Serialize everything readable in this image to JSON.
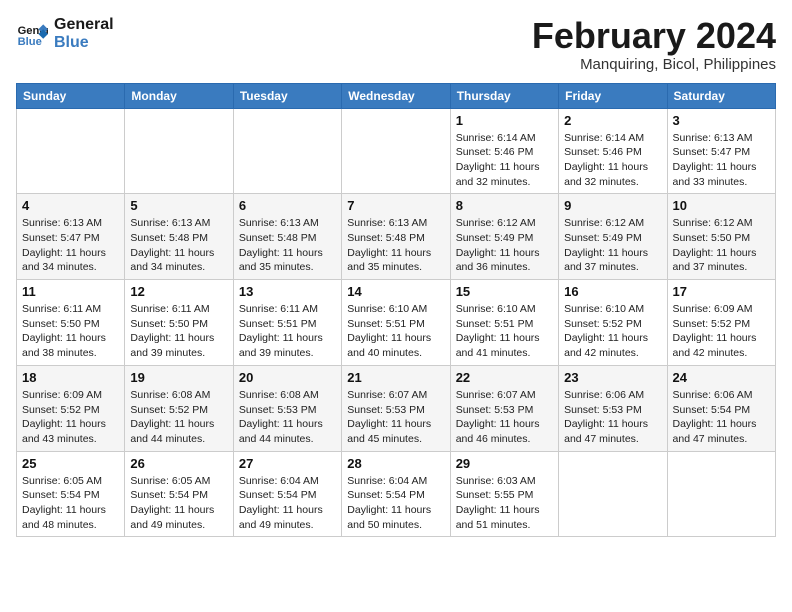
{
  "logo": {
    "line1": "General",
    "line2": "Blue"
  },
  "title": "February 2024",
  "subtitle": "Manquiring, Bicol, Philippines",
  "days_of_week": [
    "Sunday",
    "Monday",
    "Tuesday",
    "Wednesday",
    "Thursday",
    "Friday",
    "Saturday"
  ],
  "weeks": [
    [
      {
        "day": "",
        "sunrise": "",
        "sunset": "",
        "daylight": ""
      },
      {
        "day": "",
        "sunrise": "",
        "sunset": "",
        "daylight": ""
      },
      {
        "day": "",
        "sunrise": "",
        "sunset": "",
        "daylight": ""
      },
      {
        "day": "",
        "sunrise": "",
        "sunset": "",
        "daylight": ""
      },
      {
        "day": "1",
        "sunrise": "Sunrise: 6:14 AM",
        "sunset": "Sunset: 5:46 PM",
        "daylight": "Daylight: 11 hours and 32 minutes."
      },
      {
        "day": "2",
        "sunrise": "Sunrise: 6:14 AM",
        "sunset": "Sunset: 5:46 PM",
        "daylight": "Daylight: 11 hours and 32 minutes."
      },
      {
        "day": "3",
        "sunrise": "Sunrise: 6:13 AM",
        "sunset": "Sunset: 5:47 PM",
        "daylight": "Daylight: 11 hours and 33 minutes."
      }
    ],
    [
      {
        "day": "4",
        "sunrise": "Sunrise: 6:13 AM",
        "sunset": "Sunset: 5:47 PM",
        "daylight": "Daylight: 11 hours and 34 minutes."
      },
      {
        "day": "5",
        "sunrise": "Sunrise: 6:13 AM",
        "sunset": "Sunset: 5:48 PM",
        "daylight": "Daylight: 11 hours and 34 minutes."
      },
      {
        "day": "6",
        "sunrise": "Sunrise: 6:13 AM",
        "sunset": "Sunset: 5:48 PM",
        "daylight": "Daylight: 11 hours and 35 minutes."
      },
      {
        "day": "7",
        "sunrise": "Sunrise: 6:13 AM",
        "sunset": "Sunset: 5:48 PM",
        "daylight": "Daylight: 11 hours and 35 minutes."
      },
      {
        "day": "8",
        "sunrise": "Sunrise: 6:12 AM",
        "sunset": "Sunset: 5:49 PM",
        "daylight": "Daylight: 11 hours and 36 minutes."
      },
      {
        "day": "9",
        "sunrise": "Sunrise: 6:12 AM",
        "sunset": "Sunset: 5:49 PM",
        "daylight": "Daylight: 11 hours and 37 minutes."
      },
      {
        "day": "10",
        "sunrise": "Sunrise: 6:12 AM",
        "sunset": "Sunset: 5:50 PM",
        "daylight": "Daylight: 11 hours and 37 minutes."
      }
    ],
    [
      {
        "day": "11",
        "sunrise": "Sunrise: 6:11 AM",
        "sunset": "Sunset: 5:50 PM",
        "daylight": "Daylight: 11 hours and 38 minutes."
      },
      {
        "day": "12",
        "sunrise": "Sunrise: 6:11 AM",
        "sunset": "Sunset: 5:50 PM",
        "daylight": "Daylight: 11 hours and 39 minutes."
      },
      {
        "day": "13",
        "sunrise": "Sunrise: 6:11 AM",
        "sunset": "Sunset: 5:51 PM",
        "daylight": "Daylight: 11 hours and 39 minutes."
      },
      {
        "day": "14",
        "sunrise": "Sunrise: 6:10 AM",
        "sunset": "Sunset: 5:51 PM",
        "daylight": "Daylight: 11 hours and 40 minutes."
      },
      {
        "day": "15",
        "sunrise": "Sunrise: 6:10 AM",
        "sunset": "Sunset: 5:51 PM",
        "daylight": "Daylight: 11 hours and 41 minutes."
      },
      {
        "day": "16",
        "sunrise": "Sunrise: 6:10 AM",
        "sunset": "Sunset: 5:52 PM",
        "daylight": "Daylight: 11 hours and 42 minutes."
      },
      {
        "day": "17",
        "sunrise": "Sunrise: 6:09 AM",
        "sunset": "Sunset: 5:52 PM",
        "daylight": "Daylight: 11 hours and 42 minutes."
      }
    ],
    [
      {
        "day": "18",
        "sunrise": "Sunrise: 6:09 AM",
        "sunset": "Sunset: 5:52 PM",
        "daylight": "Daylight: 11 hours and 43 minutes."
      },
      {
        "day": "19",
        "sunrise": "Sunrise: 6:08 AM",
        "sunset": "Sunset: 5:52 PM",
        "daylight": "Daylight: 11 hours and 44 minutes."
      },
      {
        "day": "20",
        "sunrise": "Sunrise: 6:08 AM",
        "sunset": "Sunset: 5:53 PM",
        "daylight": "Daylight: 11 hours and 44 minutes."
      },
      {
        "day": "21",
        "sunrise": "Sunrise: 6:07 AM",
        "sunset": "Sunset: 5:53 PM",
        "daylight": "Daylight: 11 hours and 45 minutes."
      },
      {
        "day": "22",
        "sunrise": "Sunrise: 6:07 AM",
        "sunset": "Sunset: 5:53 PM",
        "daylight": "Daylight: 11 hours and 46 minutes."
      },
      {
        "day": "23",
        "sunrise": "Sunrise: 6:06 AM",
        "sunset": "Sunset: 5:53 PM",
        "daylight": "Daylight: 11 hours and 47 minutes."
      },
      {
        "day": "24",
        "sunrise": "Sunrise: 6:06 AM",
        "sunset": "Sunset: 5:54 PM",
        "daylight": "Daylight: 11 hours and 47 minutes."
      }
    ],
    [
      {
        "day": "25",
        "sunrise": "Sunrise: 6:05 AM",
        "sunset": "Sunset: 5:54 PM",
        "daylight": "Daylight: 11 hours and 48 minutes."
      },
      {
        "day": "26",
        "sunrise": "Sunrise: 6:05 AM",
        "sunset": "Sunset: 5:54 PM",
        "daylight": "Daylight: 11 hours and 49 minutes."
      },
      {
        "day": "27",
        "sunrise": "Sunrise: 6:04 AM",
        "sunset": "Sunset: 5:54 PM",
        "daylight": "Daylight: 11 hours and 49 minutes."
      },
      {
        "day": "28",
        "sunrise": "Sunrise: 6:04 AM",
        "sunset": "Sunset: 5:54 PM",
        "daylight": "Daylight: 11 hours and 50 minutes."
      },
      {
        "day": "29",
        "sunrise": "Sunrise: 6:03 AM",
        "sunset": "Sunset: 5:55 PM",
        "daylight": "Daylight: 11 hours and 51 minutes."
      },
      {
        "day": "",
        "sunrise": "",
        "sunset": "",
        "daylight": ""
      },
      {
        "day": "",
        "sunrise": "",
        "sunset": "",
        "daylight": ""
      }
    ]
  ]
}
